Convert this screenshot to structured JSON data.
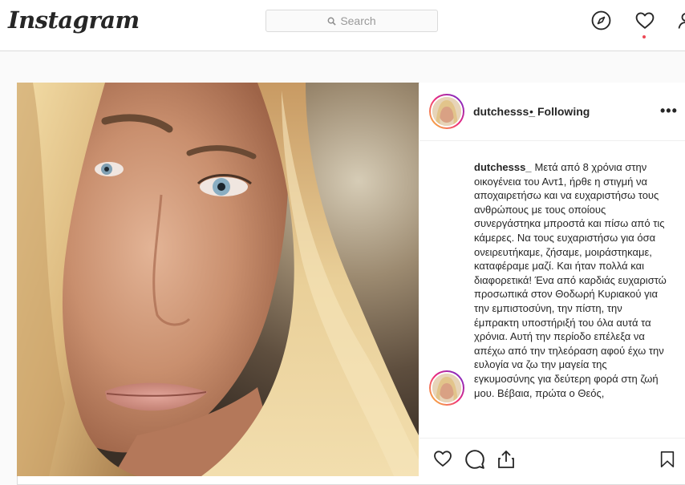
{
  "header": {
    "logo": "Instagram",
    "search_placeholder": "Search"
  },
  "icons": {
    "search": "search-icon",
    "explore": "compass-icon",
    "activity": "heart-icon",
    "profile": "profile-icon",
    "like": "heart-icon",
    "comment": "comment-icon",
    "share": "share-icon",
    "save": "bookmark-icon",
    "more": "more-options-icon"
  },
  "post": {
    "author": "dutchesss_",
    "separator": "•",
    "follow_status": "Following",
    "more_label": "•••",
    "caption": "Μετά από 8 χρόνια στην οικογένεια του Αντ1, ήρθε η στιγμή να αποχαιρετήσω και να ευχαριστήσω τους ανθρώπους με τους οποίους συνεργάστηκα μπροστά και πίσω από τις κάμερες. Να τους ευχαριστήσω για όσα ονειρευτήκαμε, ζήσαμε, μοιράστηκαμε, καταφέραμε μαζί. Και ήταν πολλά και διαφορετικά! Ένα από καρδιάς ευχαριστώ προσωπικά στον Θοδωρή Κυριακού για την εμπιστοσύνη, την πίστη, την έμπρακτη υποστήριξή του όλα αυτά τα χρόνια. Αυτή την περίοδο επέλεξα να απέχω από την τηλεόραση αφού έχω την ευλογία να ζω την μαγεία της εγκυμοσύνης για δεύτερη φορά στη ζωή μου. Βέβαια, πρώτα ο Θεός,"
  },
  "colors": {
    "border": "#dbdbdb",
    "text": "#262626",
    "notification_dot": "#ed4956",
    "avatar_ring_start": "#f9ce34",
    "avatar_ring_end": "#6228d7"
  }
}
